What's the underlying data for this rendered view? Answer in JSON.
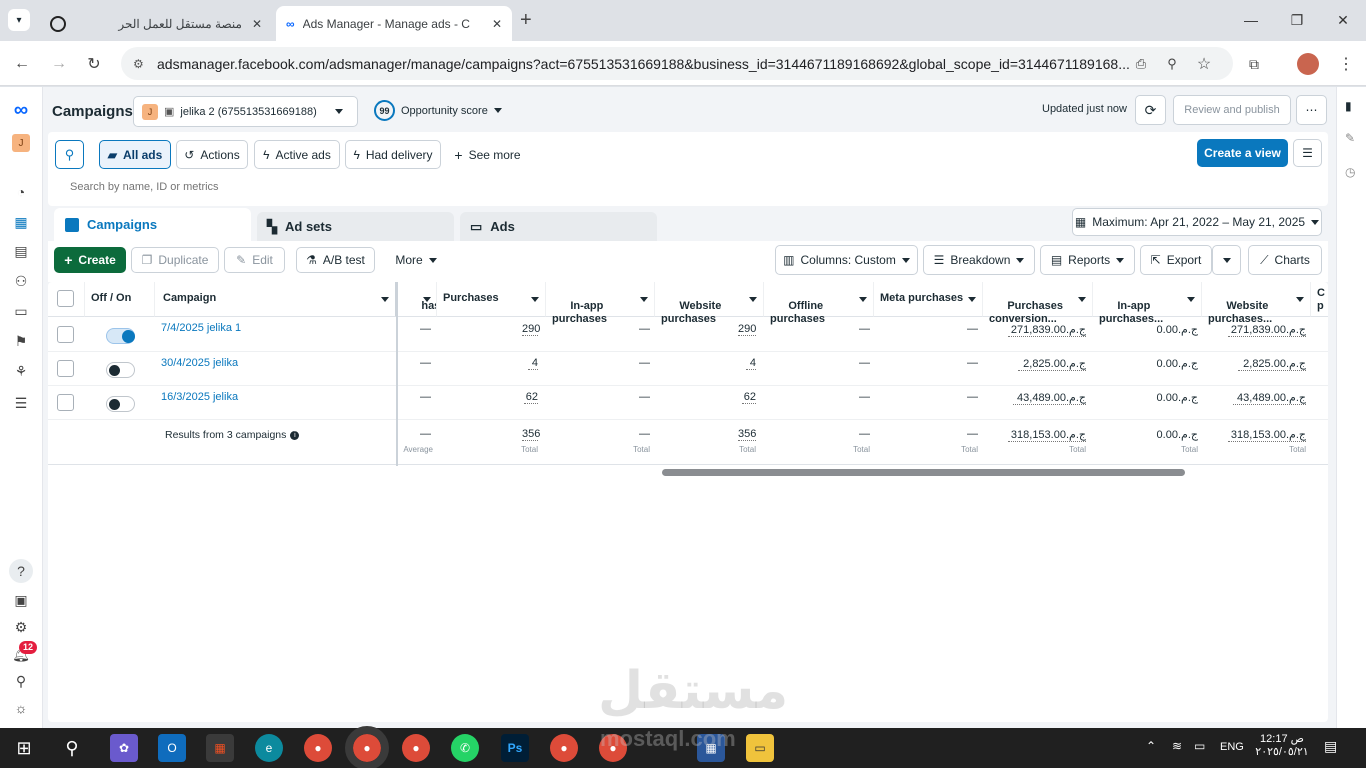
{
  "browser": {
    "tabs": [
      {
        "title": "منصة مستقل للعمل الحر",
        "active": false
      },
      {
        "title": "Ads Manager - Manage ads - C",
        "active": true
      }
    ],
    "url": "adsmanager.facebook.com/adsmanager/manage/campaigns?act=675513531669188&business_id=3144671189168692&global_scope_id=3144671189168..."
  },
  "header": {
    "title": "Campaigns",
    "account_initial": "J",
    "account_name": "jelika 2 (675513531669188)",
    "opportunity_score": "99",
    "opportunity_label": "Opportunity score",
    "updated": "Updated just now",
    "review_publish": "Review and publish"
  },
  "toolbar": {
    "all_ads": "All ads",
    "actions": "Actions",
    "active_ads": "Active ads",
    "had_delivery": "Had delivery",
    "see_more": "See more",
    "create_view": "Create a view",
    "search_placeholder": "Search by name, ID or metrics"
  },
  "level_tabs": [
    {
      "label": "Campaigns",
      "active": true
    },
    {
      "label": "Ad sets",
      "active": false
    },
    {
      "label": "Ads",
      "active": false
    }
  ],
  "date_range": "Maximum: Apr 21, 2022 – May 21, 2025",
  "actions": {
    "create": "Create",
    "duplicate": "Duplicate",
    "edit": "Edit",
    "ab_test": "A/B test",
    "more": "More",
    "columns": "Columns: Custom",
    "breakdown": "Breakdown",
    "reports": "Reports",
    "export": "Export",
    "charts": "Charts"
  },
  "table": {
    "headers": {
      "offon": "Off / On",
      "campaign": "Campaign",
      "cut": "hase\nn ...",
      "purchases": "Purchases",
      "inapp": "In-app\npurchases",
      "website": "Website\npurchases",
      "offline": "Offline\npurchases",
      "meta": "Meta purchases",
      "pconv": "Purchases\nconversion...",
      "inapp_val": "In-app\npurchases...",
      "web_val": "Website\npurchases...",
      "edge": "C\np"
    },
    "rows": [
      {
        "name": "7/4/2025 jelika 1",
        "on": true,
        "cut": "—",
        "purchases": "290",
        "inapp": "—",
        "website": "290",
        "offline": "—",
        "meta": "—",
        "pconv": "271,839.00ج.م.‏",
        "inapp_val": "0.00ج.م.‏",
        "web_val": "271,839.00ج.م.‏"
      },
      {
        "name": "30/4/2025 jelika",
        "on": false,
        "cut": "—",
        "purchases": "4",
        "inapp": "—",
        "website": "4",
        "offline": "—",
        "meta": "—",
        "pconv": "2,825.00ج.م.‏",
        "inapp_val": "0.00ج.م.‏",
        "web_val": "2,825.00ج.م.‏"
      },
      {
        "name": "16/3/2025 jelika",
        "on": false,
        "cut": "—",
        "purchases": "62",
        "inapp": "—",
        "website": "62",
        "offline": "—",
        "meta": "—",
        "pconv": "43,489.00ج.م.‏",
        "inapp_val": "0.00ج.م.‏",
        "web_val": "43,489.00ج.م.‏"
      }
    ],
    "summary": {
      "label": "Results from 3 campaigns",
      "cut": "—",
      "cut_sub": "Average",
      "purchases": "356",
      "purchases_sub": "Total",
      "inapp": "—",
      "inapp_sub": "Total",
      "website": "356",
      "website_sub": "Total",
      "offline": "—",
      "offline_sub": "Total",
      "meta": "—",
      "meta_sub": "Total",
      "pconv": "318,153.00ج.م.‏",
      "pconv_sub": "Total",
      "inapp_val": "0.00ج.م.‏",
      "inapp_val_sub": "Total",
      "web_val": "318,153.00ج.م.‏",
      "web_val_sub": "Total"
    }
  },
  "leftnav": {
    "notif_count": "12"
  },
  "watermark": {
    "text": "مستقل",
    "sub": "mostaql.com"
  },
  "taskbar": {
    "time": "12:17 ص",
    "date": "٢٠٢٥/٠٥/٢١",
    "lang": "ENG"
  },
  "colors": {
    "primary": "#0a78be",
    "create_green": "#0c6b3c",
    "taskbar": "#202020"
  }
}
